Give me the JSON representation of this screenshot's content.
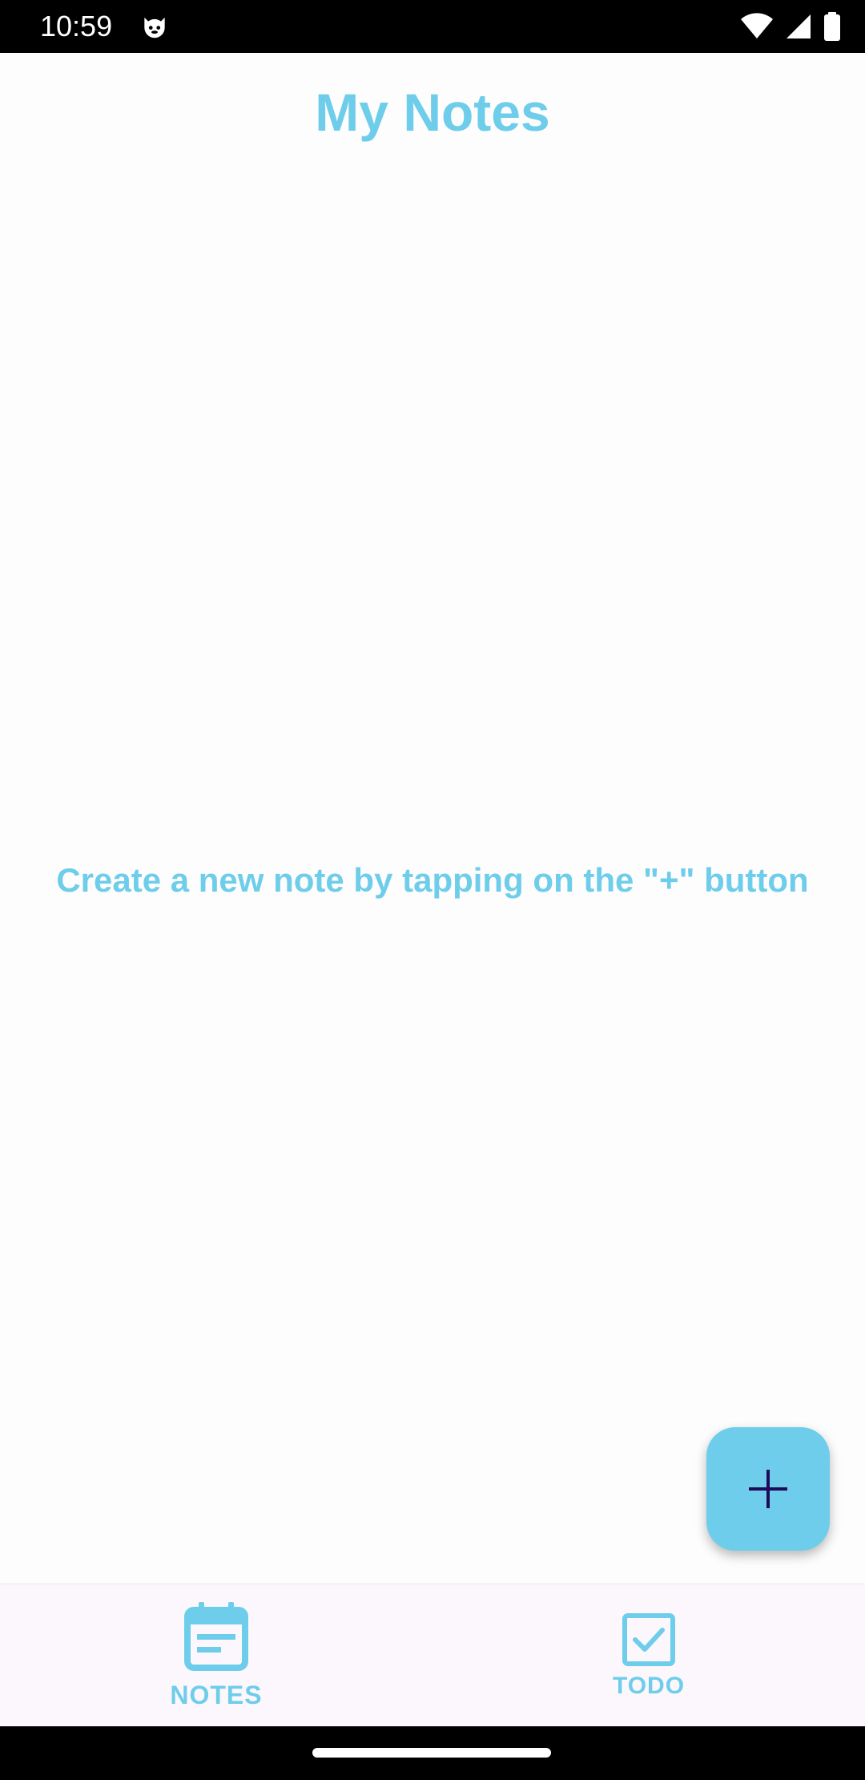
{
  "status_bar": {
    "time": "10:59",
    "app_icon": "cat-face-icon",
    "wifi_icon": "wifi-icon",
    "signal_icon": "cell-signal-icon",
    "battery_icon": "battery-icon"
  },
  "header": {
    "title": "My Notes"
  },
  "main": {
    "empty_message": "Create a new note by tapping on the \"+\" button"
  },
  "fab": {
    "icon": "plus-icon"
  },
  "bottom_nav": {
    "items": [
      {
        "label": "NOTES",
        "icon": "notes-calendar-icon",
        "selected": true
      },
      {
        "label": "TODO",
        "icon": "checkbox-icon",
        "selected": false
      }
    ]
  },
  "colors": {
    "accent": "#6ecdea",
    "fab_icon": "#1f0a5a",
    "nav_background": "#fcf7fc"
  }
}
